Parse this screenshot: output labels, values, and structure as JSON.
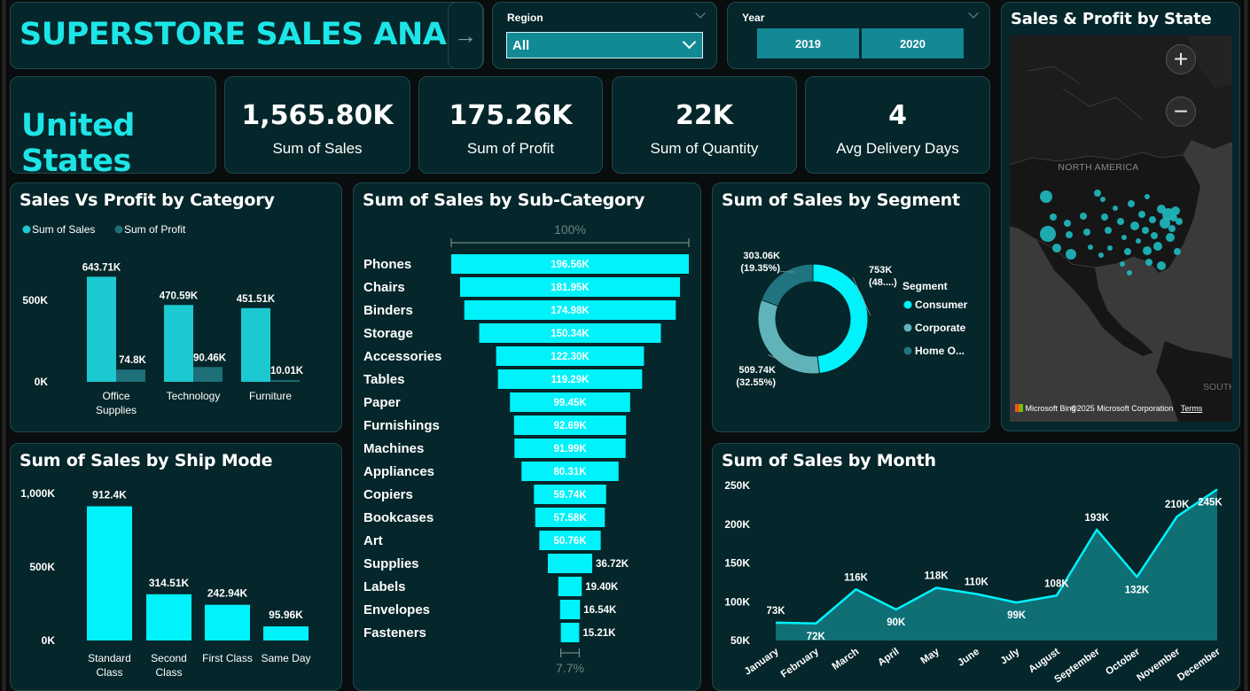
{
  "header": {
    "title": "SUPERSTORE SALES ANALYSIS",
    "arrow": "→"
  },
  "region_slicer": {
    "label": "Region",
    "value": "All"
  },
  "year_slicer": {
    "label": "Year",
    "options": [
      "2019",
      "2020"
    ]
  },
  "country": "United States",
  "kpis": [
    {
      "value": "1,565.80K",
      "label": "Sum of Sales"
    },
    {
      "value": "175.26K",
      "label": "Sum of Profit"
    },
    {
      "value": "22K",
      "label": "Sum of Quantity"
    },
    {
      "value": "4",
      "label": "Avg Delivery Days"
    }
  ],
  "map": {
    "title": "Sales & Profit by State",
    "zoom_in": "+",
    "zoom_out": "−",
    "continent_label": "NORTH AMERICA",
    "south_label": "SOUTH",
    "attribution": "Microsoft Bing",
    "copyright": "©2025 Microsoft Corporation",
    "terms": "Terms",
    "bubble_color": "#1fb3b8"
  },
  "colors": {
    "accent": "#00f2fa",
    "sales": "#1dc9d0",
    "profit": "#1d6f78",
    "card_bg": "#05262a",
    "segment_consumer": "#00f2fa",
    "segment_corporate": "#5fb3b9",
    "segment_home": "#1f7480",
    "area_fill": "#0f6f75"
  },
  "chart_data": [
    {
      "id": "category",
      "type": "bar",
      "title": "Sales Vs Profit by Category",
      "categories": [
        "Office Supplies",
        "Technology",
        "Furniture"
      ],
      "series": [
        {
          "name": "Sum of Sales",
          "values": [
            643.71,
            470.59,
            451.51
          ],
          "labels": [
            "643.71K",
            "470.59K",
            "451.51K"
          ]
        },
        {
          "name": "Sum of Profit",
          "values": [
            74.8,
            90.46,
            10.01
          ],
          "labels": [
            "74.8K",
            "90.46K",
            "10.01K"
          ]
        }
      ],
      "ylim": [
        0,
        700
      ],
      "yticks": [
        {
          "v": 0,
          "label": "0K"
        },
        {
          "v": 500,
          "label": "500K"
        }
      ],
      "legend": "top-left"
    },
    {
      "id": "subcategory",
      "type": "bar",
      "title": "Sum of Sales by Sub-Category",
      "top_pct": "100%",
      "bottom_pct": "7.7%",
      "categories": [
        "Phones",
        "Chairs",
        "Binders",
        "Storage",
        "Accessories",
        "Tables",
        "Paper",
        "Furnishings",
        "Machines",
        "Appliances",
        "Copiers",
        "Bookcases",
        "Art",
        "Supplies",
        "Labels",
        "Envelopes",
        "Fasteners"
      ],
      "values": [
        196.56,
        181.95,
        174.98,
        150.34,
        122.3,
        119.29,
        99.45,
        92.69,
        91.99,
        80.31,
        59.74,
        57.58,
        50.76,
        36.72,
        19.4,
        16.54,
        15.21
      ],
      "labels": [
        "196.56K",
        "181.95K",
        "174.98K",
        "150.34K",
        "122.30K",
        "119.29K",
        "99.45K",
        "92.69K",
        "91.99K",
        "80.31K",
        "59.74K",
        "57.58K",
        "50.76K",
        "36.72K",
        "19.40K",
        "16.54K",
        "15.21K"
      ]
    },
    {
      "id": "segment",
      "type": "pie",
      "title": "Sum of Sales by Segment",
      "legend_title": "Segment",
      "categories": [
        "Consumer",
        "Corporate",
        "Home O..."
      ],
      "values": [
        753,
        509.74,
        303.06
      ],
      "value_labels": [
        "753K",
        "509.74K",
        "303.06K"
      ],
      "pct_labels": [
        "(48....)",
        "(32.55%)",
        "(19.35%)"
      ],
      "legend": "right"
    },
    {
      "id": "shipmode",
      "type": "bar",
      "title": "Sum of Sales by Ship Mode",
      "categories": [
        "Standard Class",
        "Second Class",
        "First Class",
        "Same Day"
      ],
      "category_lines": [
        [
          "Standard",
          "Class"
        ],
        [
          "Second",
          "Class"
        ],
        [
          "First Class"
        ],
        [
          "Same Day"
        ]
      ],
      "values": [
        912.4,
        314.51,
        242.94,
        95.96
      ],
      "labels": [
        "912.4K",
        "314.51K",
        "242.94K",
        "95.96K"
      ],
      "ylim": [
        0,
        1000
      ],
      "yticks": [
        {
          "v": 0,
          "label": "0K"
        },
        {
          "v": 500,
          "label": "500K"
        },
        {
          "v": 1000,
          "label": "1,000K"
        }
      ]
    },
    {
      "id": "month",
      "type": "area",
      "title": "Sum of Sales by Month",
      "categories": [
        "January",
        "February",
        "March",
        "April",
        "May",
        "June",
        "July",
        "August",
        "September",
        "October",
        "November",
        "December"
      ],
      "values": [
        73,
        72,
        116,
        90,
        118,
        110,
        99,
        108,
        193,
        132,
        210,
        245
      ],
      "labels": [
        "73K",
        "72K",
        "116K",
        "90K",
        "118K",
        "110K",
        "99K",
        "108K",
        "193K",
        "132K",
        "210K",
        "245K"
      ],
      "ylim": [
        50,
        250
      ],
      "yticks": [
        {
          "v": 50,
          "label": "50K"
        },
        {
          "v": 100,
          "label": "100K"
        },
        {
          "v": 150,
          "label": "150K"
        },
        {
          "v": 200,
          "label": "200K"
        },
        {
          "v": 250,
          "label": "250K"
        }
      ]
    }
  ]
}
